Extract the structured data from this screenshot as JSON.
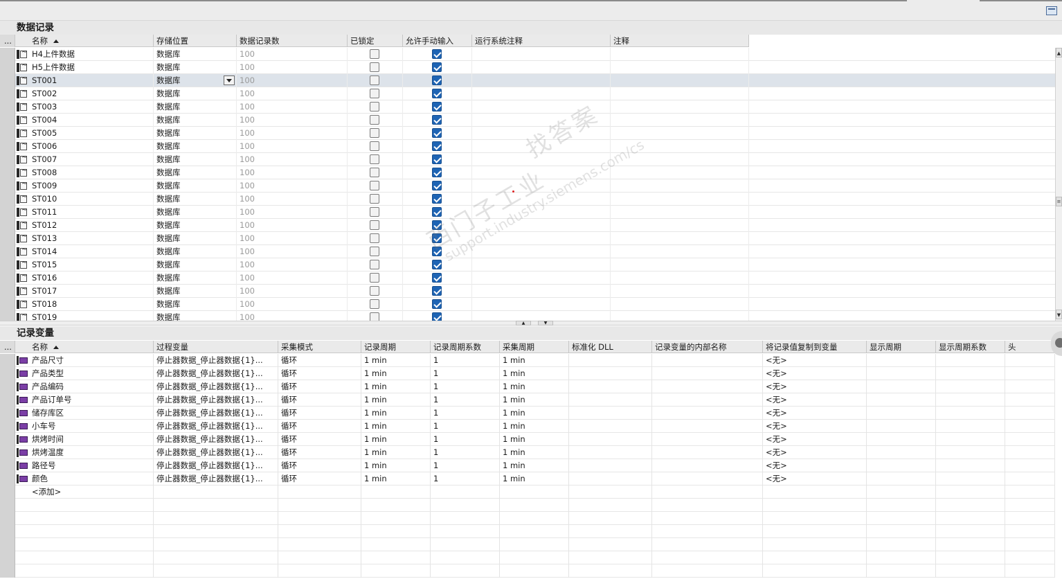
{
  "upper": {
    "title": "数据记录",
    "columns": [
      "...",
      "名称",
      "存储位置",
      "数据记录数",
      "已锁定",
      "允许手动输入",
      "运行系统注释",
      "注释"
    ],
    "rows": [
      {
        "name": "H4上件数据",
        "storage": "数据库",
        "count": "100",
        "locked": false,
        "manual": true
      },
      {
        "name": "H5上件数据",
        "storage": "数据库",
        "count": "100",
        "locked": false,
        "manual": true
      },
      {
        "name": "ST001",
        "storage": "数据库",
        "count": "100",
        "locked": false,
        "manual": true
      },
      {
        "name": "ST002",
        "storage": "数据库",
        "count": "100",
        "locked": false,
        "manual": true
      },
      {
        "name": "ST003",
        "storage": "数据库",
        "count": "100",
        "locked": false,
        "manual": true
      },
      {
        "name": "ST004",
        "storage": "数据库",
        "count": "100",
        "locked": false,
        "manual": true
      },
      {
        "name": "ST005",
        "storage": "数据库",
        "count": "100",
        "locked": false,
        "manual": true
      },
      {
        "name": "ST006",
        "storage": "数据库",
        "count": "100",
        "locked": false,
        "manual": true
      },
      {
        "name": "ST007",
        "storage": "数据库",
        "count": "100",
        "locked": false,
        "manual": true
      },
      {
        "name": "ST008",
        "storage": "数据库",
        "count": "100",
        "locked": false,
        "manual": true
      },
      {
        "name": "ST009",
        "storage": "数据库",
        "count": "100",
        "locked": false,
        "manual": true
      },
      {
        "name": "ST010",
        "storage": "数据库",
        "count": "100",
        "locked": false,
        "manual": true
      },
      {
        "name": "ST011",
        "storage": "数据库",
        "count": "100",
        "locked": false,
        "manual": true
      },
      {
        "name": "ST012",
        "storage": "数据库",
        "count": "100",
        "locked": false,
        "manual": true
      },
      {
        "name": "ST013",
        "storage": "数据库",
        "count": "100",
        "locked": false,
        "manual": true
      },
      {
        "name": "ST014",
        "storage": "数据库",
        "count": "100",
        "locked": false,
        "manual": true
      },
      {
        "name": "ST015",
        "storage": "数据库",
        "count": "100",
        "locked": false,
        "manual": true
      },
      {
        "name": "ST016",
        "storage": "数据库",
        "count": "100",
        "locked": false,
        "manual": true
      },
      {
        "name": "ST017",
        "storage": "数据库",
        "count": "100",
        "locked": false,
        "manual": true
      },
      {
        "name": "ST018",
        "storage": "数据库",
        "count": "100",
        "locked": false,
        "manual": true
      },
      {
        "name": "ST019",
        "storage": "数据库",
        "count": "100",
        "locked": false,
        "manual": true
      }
    ]
  },
  "lower": {
    "title": "记录变量",
    "columns": [
      "...",
      "名称",
      "过程变量",
      "采集模式",
      "记录周期",
      "记录周期系数",
      "采集周期",
      "标准化 DLL",
      "记录变量的内部名称",
      "将记录值复制到变量",
      "显示周期",
      "显示周期系数",
      "头"
    ],
    "rows": [
      {
        "name": "产品尺寸",
        "tag": "停止器数据_停止器数据{1}...",
        "mode": "循环",
        "period": "1 min",
        "factor": "1",
        "acq": "1 min",
        "copy": "<无>"
      },
      {
        "name": "产品类型",
        "tag": "停止器数据_停止器数据{1}...",
        "mode": "循环",
        "period": "1 min",
        "factor": "1",
        "acq": "1 min",
        "copy": "<无>"
      },
      {
        "name": "产品编码",
        "tag": "停止器数据_停止器数据{1}...",
        "mode": "循环",
        "period": "1 min",
        "factor": "1",
        "acq": "1 min",
        "copy": "<无>"
      },
      {
        "name": "产品订单号",
        "tag": "停止器数据_停止器数据{1}...",
        "mode": "循环",
        "period": "1 min",
        "factor": "1",
        "acq": "1 min",
        "copy": "<无>"
      },
      {
        "name": "储存库区",
        "tag": "停止器数据_停止器数据{1}...",
        "mode": "循环",
        "period": "1 min",
        "factor": "1",
        "acq": "1 min",
        "copy": "<无>"
      },
      {
        "name": "小车号",
        "tag": "停止器数据_停止器数据{1}...",
        "mode": "循环",
        "period": "1 min",
        "factor": "1",
        "acq": "1 min",
        "copy": "<无>"
      },
      {
        "name": "烘烤时间",
        "tag": "停止器数据_停止器数据{1}...",
        "mode": "循环",
        "period": "1 min",
        "factor": "1",
        "acq": "1 min",
        "copy": "<无>"
      },
      {
        "name": "烘烤温度",
        "tag": "停止器数据_停止器数据{1}...",
        "mode": "循环",
        "period": "1 min",
        "factor": "1",
        "acq": "1 min",
        "copy": "<无>"
      },
      {
        "name": "路径号",
        "tag": "停止器数据_停止器数据{1}...",
        "mode": "循环",
        "period": "1 min",
        "factor": "1",
        "acq": "1 min",
        "copy": "<无>"
      },
      {
        "name": "颜色",
        "tag": "停止器数据_停止器数据{1}...",
        "mode": "循环",
        "period": "1 min",
        "factor": "1",
        "acq": "1 min",
        "copy": "<无>"
      }
    ],
    "add_label": "<添加>"
  },
  "watermark": {
    "line1": "找答案",
    "line2": "西门子工业",
    "line3": "support.industry.siemens.com/cs"
  },
  "colors": {
    "checkbox_on": "#1e64b4",
    "selected_row": "#dde3ea",
    "variable_icon": "#7b3ea6"
  }
}
